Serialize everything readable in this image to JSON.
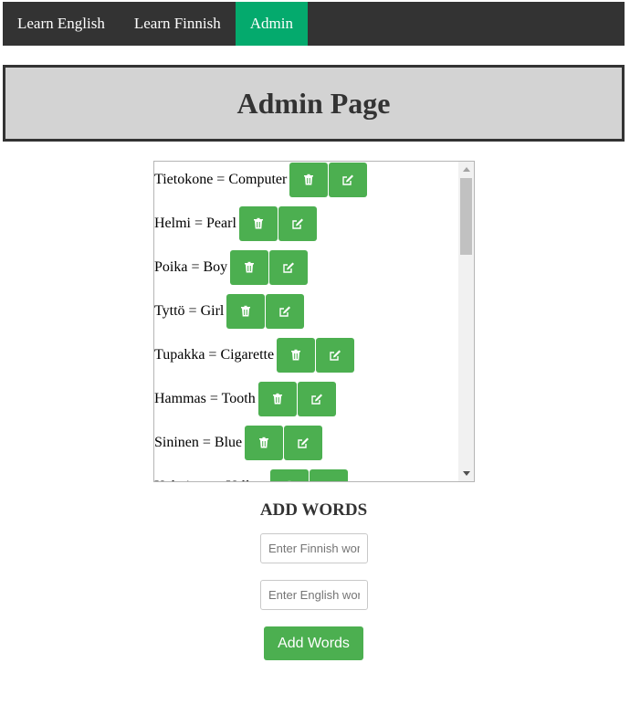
{
  "nav": {
    "items": [
      {
        "label": "Learn English",
        "active": false
      },
      {
        "label": "Learn Finnish",
        "active": false
      },
      {
        "label": "Admin",
        "active": true
      }
    ]
  },
  "header": {
    "title": "Admin Page"
  },
  "words": [
    {
      "text": "Tietokone = Computer"
    },
    {
      "text": "Helmi = Pearl"
    },
    {
      "text": "Poika = Boy"
    },
    {
      "text": "Tyttö = Girl"
    },
    {
      "text": "Tupakka = Cigarette"
    },
    {
      "text": "Hammas = Tooth"
    },
    {
      "text": "Sininen = Blue"
    },
    {
      "text": "Keltainen = Yellow"
    }
  ],
  "icons": {
    "delete": "trash-icon",
    "edit": "edit-icon"
  },
  "add_section": {
    "title": "ADD WORDS",
    "finnish_placeholder": "Enter Finnish word",
    "english_placeholder": "Enter English word",
    "button_label": "Add Words"
  },
  "colors": {
    "accent": "#4caf50",
    "nav_active": "#04aa6d",
    "nav_bg": "#333333",
    "header_bg": "#d3d3d3"
  }
}
